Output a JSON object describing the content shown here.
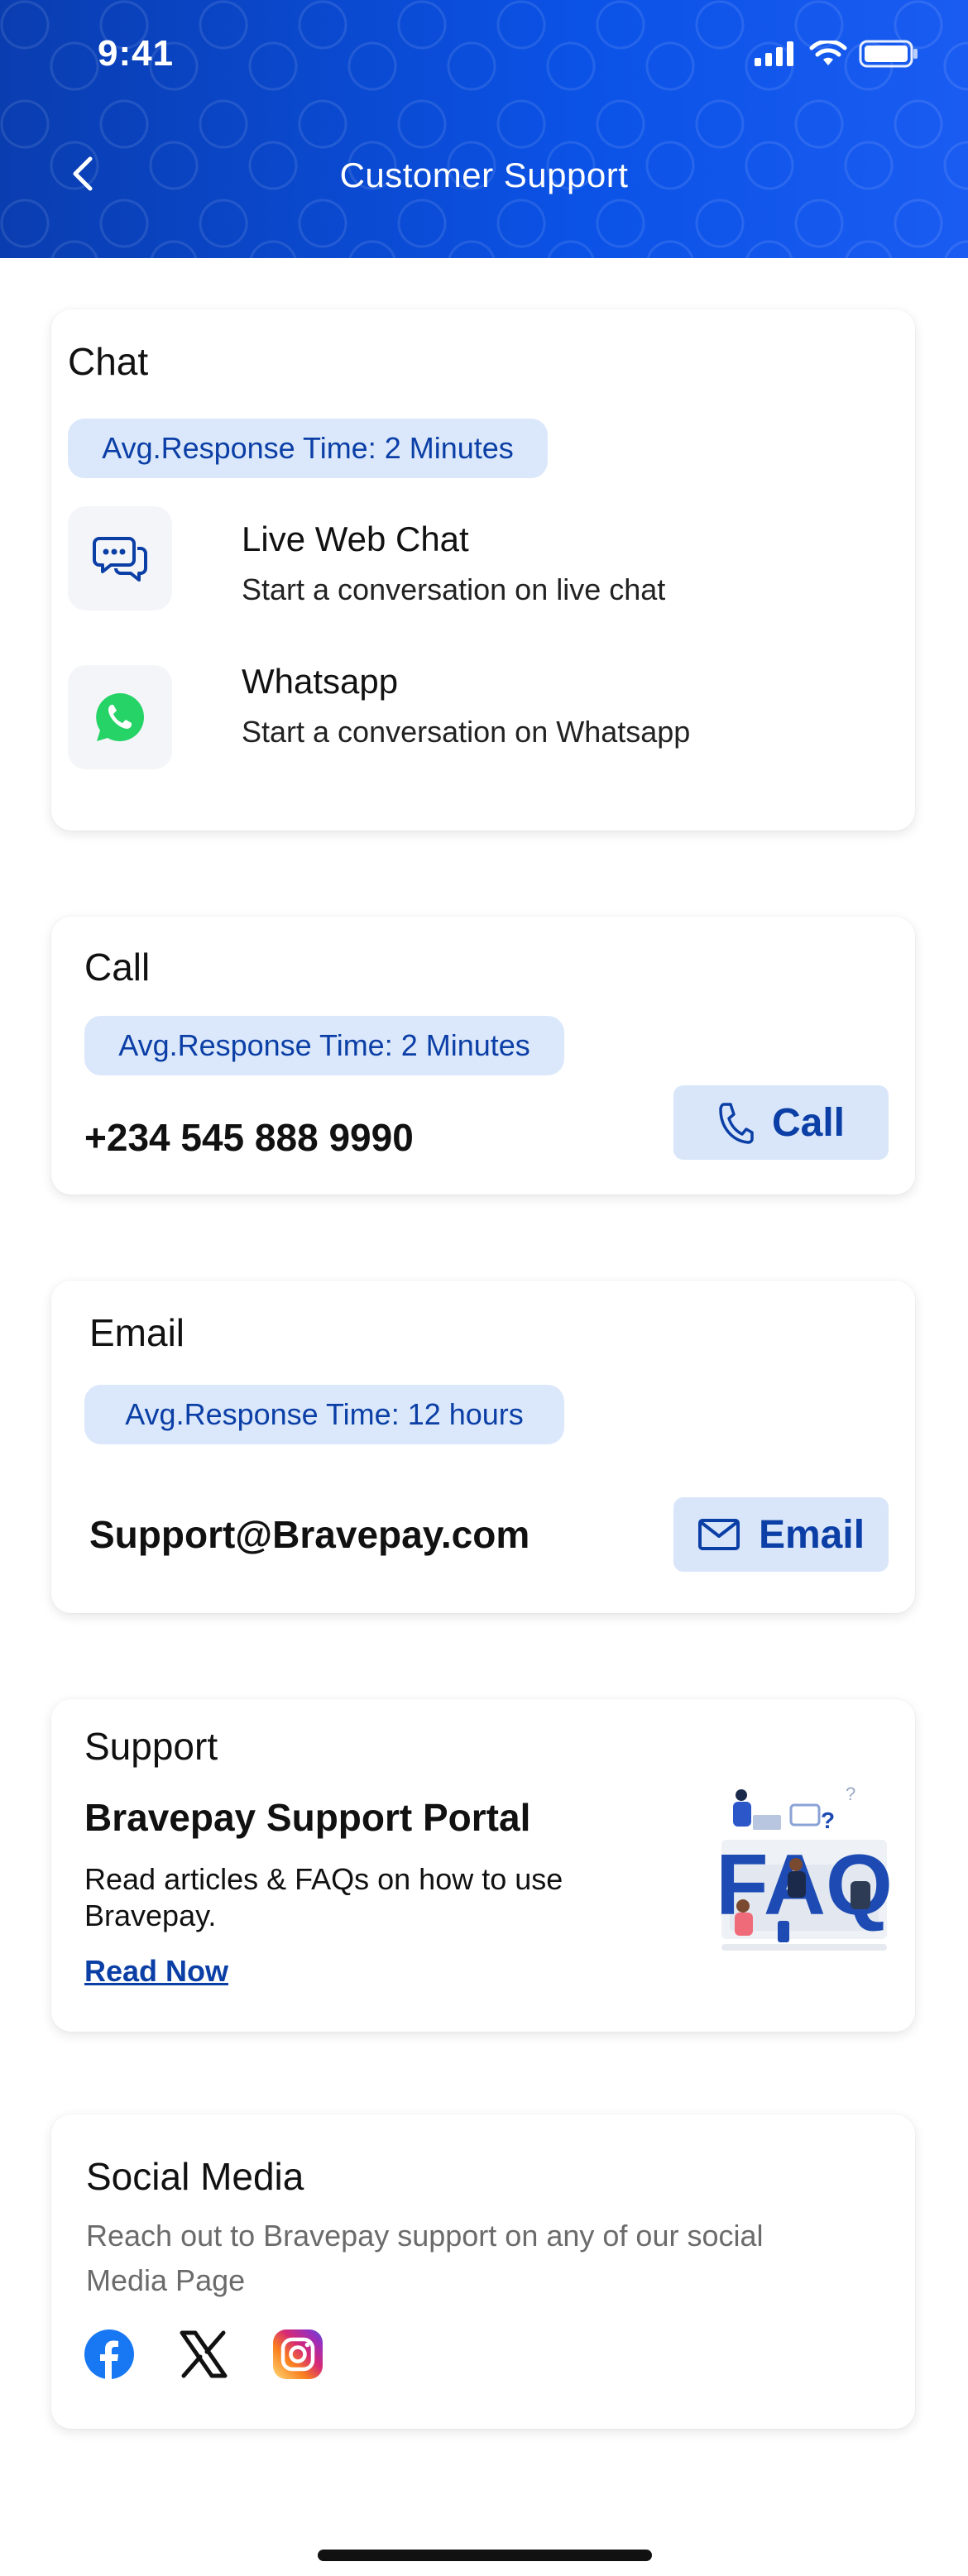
{
  "status_bar": {
    "time": "9:41"
  },
  "header": {
    "title": "Customer Support"
  },
  "chat": {
    "title": "Chat",
    "response_time": "Avg.Response Time: 2 Minutes",
    "items": [
      {
        "title": "Live Web Chat",
        "subtitle": "Start a conversation on live chat",
        "icon": "chat-bubbles-icon"
      },
      {
        "title": "Whatsapp",
        "subtitle": "Start a conversation on Whatsapp",
        "icon": "whatsapp-icon"
      }
    ]
  },
  "call": {
    "title": "Call",
    "response_time": "Avg.Response Time: 2 Minutes",
    "phone": "+234 545 888 9990",
    "button_label": "Call"
  },
  "email": {
    "title": "Email",
    "response_time": "Avg.Response Time: 12 hours",
    "address": "Support@Bravepay.com",
    "button_label": "Email"
  },
  "support": {
    "title": "Support",
    "portal_title": "Bravepay Support Portal",
    "description": "Read articles & FAQs on how to use Bravepay.",
    "link_label": "Read Now",
    "illustration_text": "FAQ"
  },
  "social": {
    "title": "Social Media",
    "description": "Reach out to Bravepay support on any of our social Media Page",
    "icons": [
      "facebook-icon",
      "x-icon",
      "instagram-icon"
    ]
  },
  "colors": {
    "primary": "#0b52e6",
    "accent_text": "#0b3fa6",
    "pill_bg": "#dbe8fb",
    "whatsapp": "#25D366",
    "facebook": "#1877F2"
  }
}
